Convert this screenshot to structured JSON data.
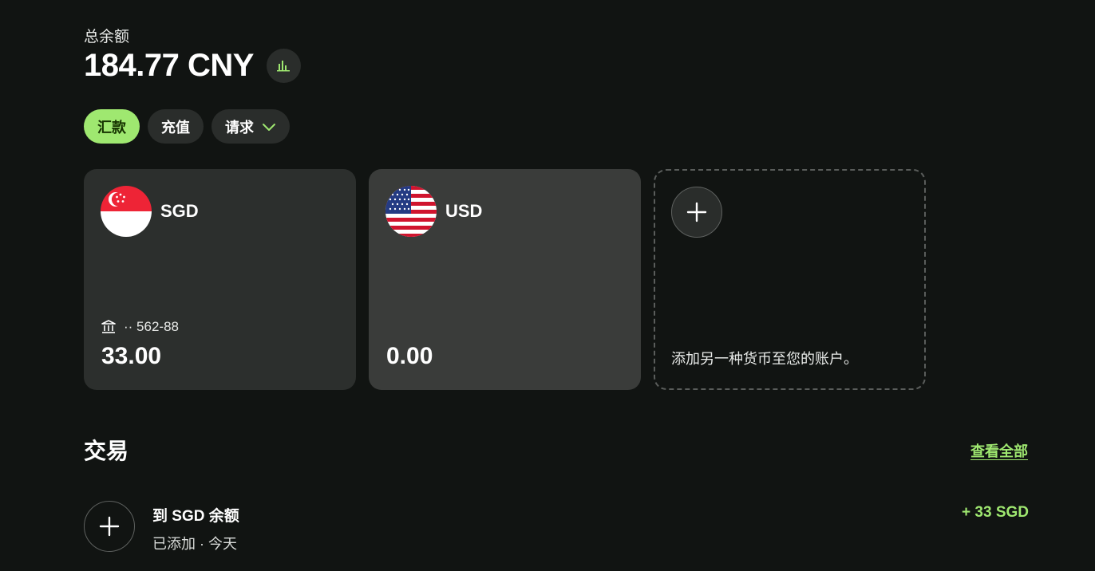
{
  "summary": {
    "label": "总余额",
    "amount": "184.77 CNY",
    "chart_icon": "bar-chart-icon"
  },
  "actions": {
    "send_label": "汇款",
    "topup_label": "充值",
    "request_label": "请求"
  },
  "balances": [
    {
      "currency": "SGD",
      "flag_icon": "singapore-flag-icon",
      "account_mask": "·· 562-88",
      "amount": "33.00"
    },
    {
      "currency": "USD",
      "flag_icon": "us-flag-icon",
      "amount": "0.00"
    }
  ],
  "add_currency": {
    "text": "添加另一种货币至您的账户。"
  },
  "transactions": {
    "title": "交易",
    "see_all_label": "查看全部",
    "items": [
      {
        "title": "到 SGD 余额",
        "subtitle": "已添加 · 今天",
        "amount": "+ 33 SGD",
        "icon": "plus-icon"
      }
    ]
  },
  "colors": {
    "background": "#111412",
    "accent": "#9fe870",
    "accent_text": "#163300",
    "card_sgd": "#2c2f2d",
    "card_usd": "#3a3c3a"
  }
}
